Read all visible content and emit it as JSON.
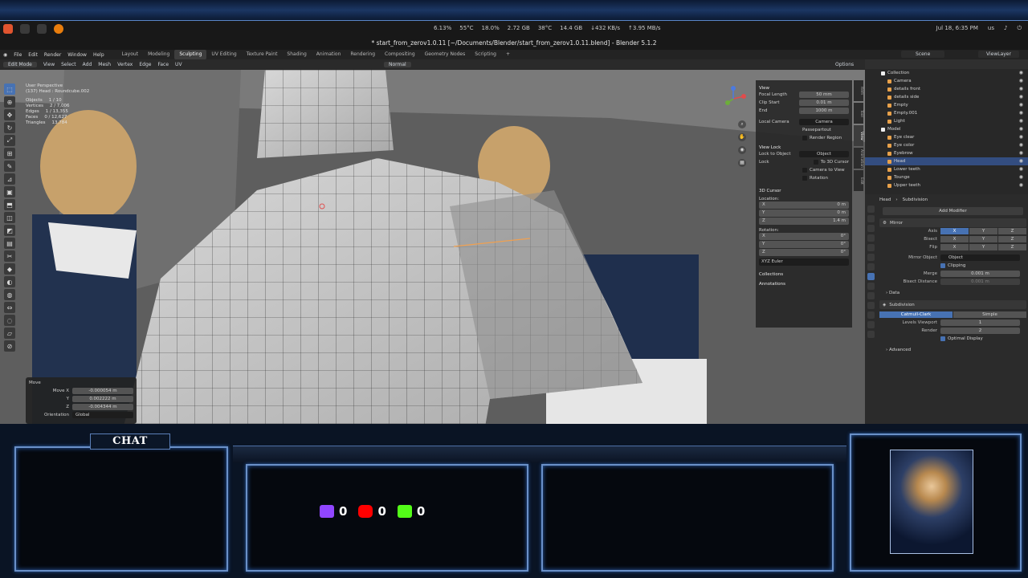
{
  "system": {
    "stats": [
      "6.13%",
      "55°C",
      "18.0%",
      "2.72 GB",
      "38°C",
      "14.4 GB",
      "↓432 KB/s",
      "↑3.95 MB/s"
    ],
    "datetime": "Jul 18, 6:35 PM",
    "keyboard": "us"
  },
  "window": {
    "title": "* start_from_zerov1.0.11 [~/Documents/Blender/start_from_zerov1.0.11.blend] - Blender 5.1.2"
  },
  "menu": {
    "items": [
      "File",
      "Edit",
      "Render",
      "Window",
      "Help"
    ],
    "workspaces": [
      "Layout",
      "Modeling",
      "Sculpting",
      "UV Editing",
      "Texture Paint",
      "Shading",
      "Animation",
      "Rendering",
      "Compositing",
      "Geometry Nodes",
      "Scripting"
    ],
    "add": "+",
    "scene": "Scene",
    "view_layer": "ViewLayer"
  },
  "header3d": {
    "mode": "Edit Mode",
    "items": [
      "View",
      "Select",
      "Add",
      "Mesh",
      "Vertex",
      "Edge",
      "Face",
      "UV"
    ],
    "orientation": "Normal",
    "options": "Options"
  },
  "viewport": {
    "perspective": "User Perspective",
    "object": "(137) Head : Roundcube.002",
    "stats": [
      {
        "label": "Objects",
        "value": "1 / 10"
      },
      {
        "label": "Vertices",
        "value": "2 / 7,006"
      },
      {
        "label": "Edges",
        "value": "1 / 13,355"
      },
      {
        "label": "Faces",
        "value": "0 / 12,627"
      },
      {
        "label": "Triangles",
        "value": "13,784"
      }
    ]
  },
  "npanel": {
    "view_title": "View",
    "focal_label": "Focal Length",
    "focal": "50 mm",
    "clip_label": "Clip Start",
    "clip_start": "0.01 m",
    "end_label": "End",
    "clip_end": "1000 m",
    "local_cam_label": "Local Camera",
    "local_cam": "Camera",
    "passepartout": "Passepartout",
    "render_region": "Render Region",
    "view_lock_title": "View Lock",
    "lock_obj_label": "Lock to Object",
    "lock_obj": "Object",
    "lock_label": "Lock",
    "to_cursor": "To 3D Cursor",
    "cam_to_view": "Camera to View",
    "rotation_chk": "Rotation",
    "cursor_title": "3D Cursor",
    "location_label": "Location:",
    "loc_x": "0 m",
    "loc_y": "0 m",
    "loc_z": "1.4 m",
    "rotation_label": "Rotation:",
    "rot_x": "0°",
    "rot_y": "0°",
    "rot_z": "0°",
    "euler": "XYZ Euler",
    "collections": "Collections",
    "annotations": "Annotations",
    "tabs": [
      "Item",
      "Tool",
      "View",
      "Animation",
      "Edit"
    ]
  },
  "operator": {
    "title": "Move",
    "move_x_label": "Move X",
    "move_x": "-0.000054 m",
    "y_label": "Y",
    "y": "0.002222 m",
    "z_label": "Z",
    "z": "-0.004344 m",
    "orientation_label": "Orientation",
    "orientation": "Global"
  },
  "outliner": {
    "search": "",
    "items": [
      {
        "name": "Collection",
        "kind": "col"
      },
      {
        "name": "Camera",
        "kind": "obj"
      },
      {
        "name": "details front",
        "kind": "obj"
      },
      {
        "name": "details side",
        "kind": "obj"
      },
      {
        "name": "Empty",
        "kind": "obj"
      },
      {
        "name": "Empty.001",
        "kind": "obj"
      },
      {
        "name": "Light",
        "kind": "obj"
      },
      {
        "name": "Model",
        "kind": "col"
      },
      {
        "name": "Eye clear",
        "kind": "obj"
      },
      {
        "name": "Eye color",
        "kind": "obj"
      },
      {
        "name": "Eyebrow",
        "kind": "obj"
      },
      {
        "name": "Head",
        "kind": "obj",
        "selected": true
      },
      {
        "name": "Lower teeth",
        "kind": "obj"
      },
      {
        "name": "Tounge",
        "kind": "obj"
      },
      {
        "name": "Upper teeth",
        "kind": "obj"
      }
    ]
  },
  "properties": {
    "object": "Head",
    "modifier_crumb": "Subdivision",
    "add_modifier": "Add Modifier",
    "mirror": {
      "name": "Mirror",
      "axis_label": "Axis",
      "bisect_label": "Bisect",
      "flip_label": "Flip",
      "x": "X",
      "y": "Y",
      "z": "Z",
      "mirror_obj_label": "Mirror Object",
      "mirror_obj": "Object",
      "clipping": "Clipping",
      "merge_label": "Merge",
      "merge": "0.001 m",
      "bisect_dist_label": "Bisect Distance",
      "bisect_dist": "0.001 m",
      "data": "Data"
    },
    "subdivision": {
      "name": "Subdivision",
      "catmull": "Catmull-Clark",
      "simple": "Simple",
      "levels_label": "Levels Viewport",
      "levels": "1",
      "render_label": "Render",
      "render": "2",
      "optimal": "Optimal Display",
      "advanced": "Advanced"
    }
  },
  "stream": {
    "chat_title": "CHAT",
    "twitch": "0",
    "youtube": "0",
    "kick": "0"
  },
  "colors": {
    "accent": "#4772b3",
    "frame": "#6a90c8"
  }
}
